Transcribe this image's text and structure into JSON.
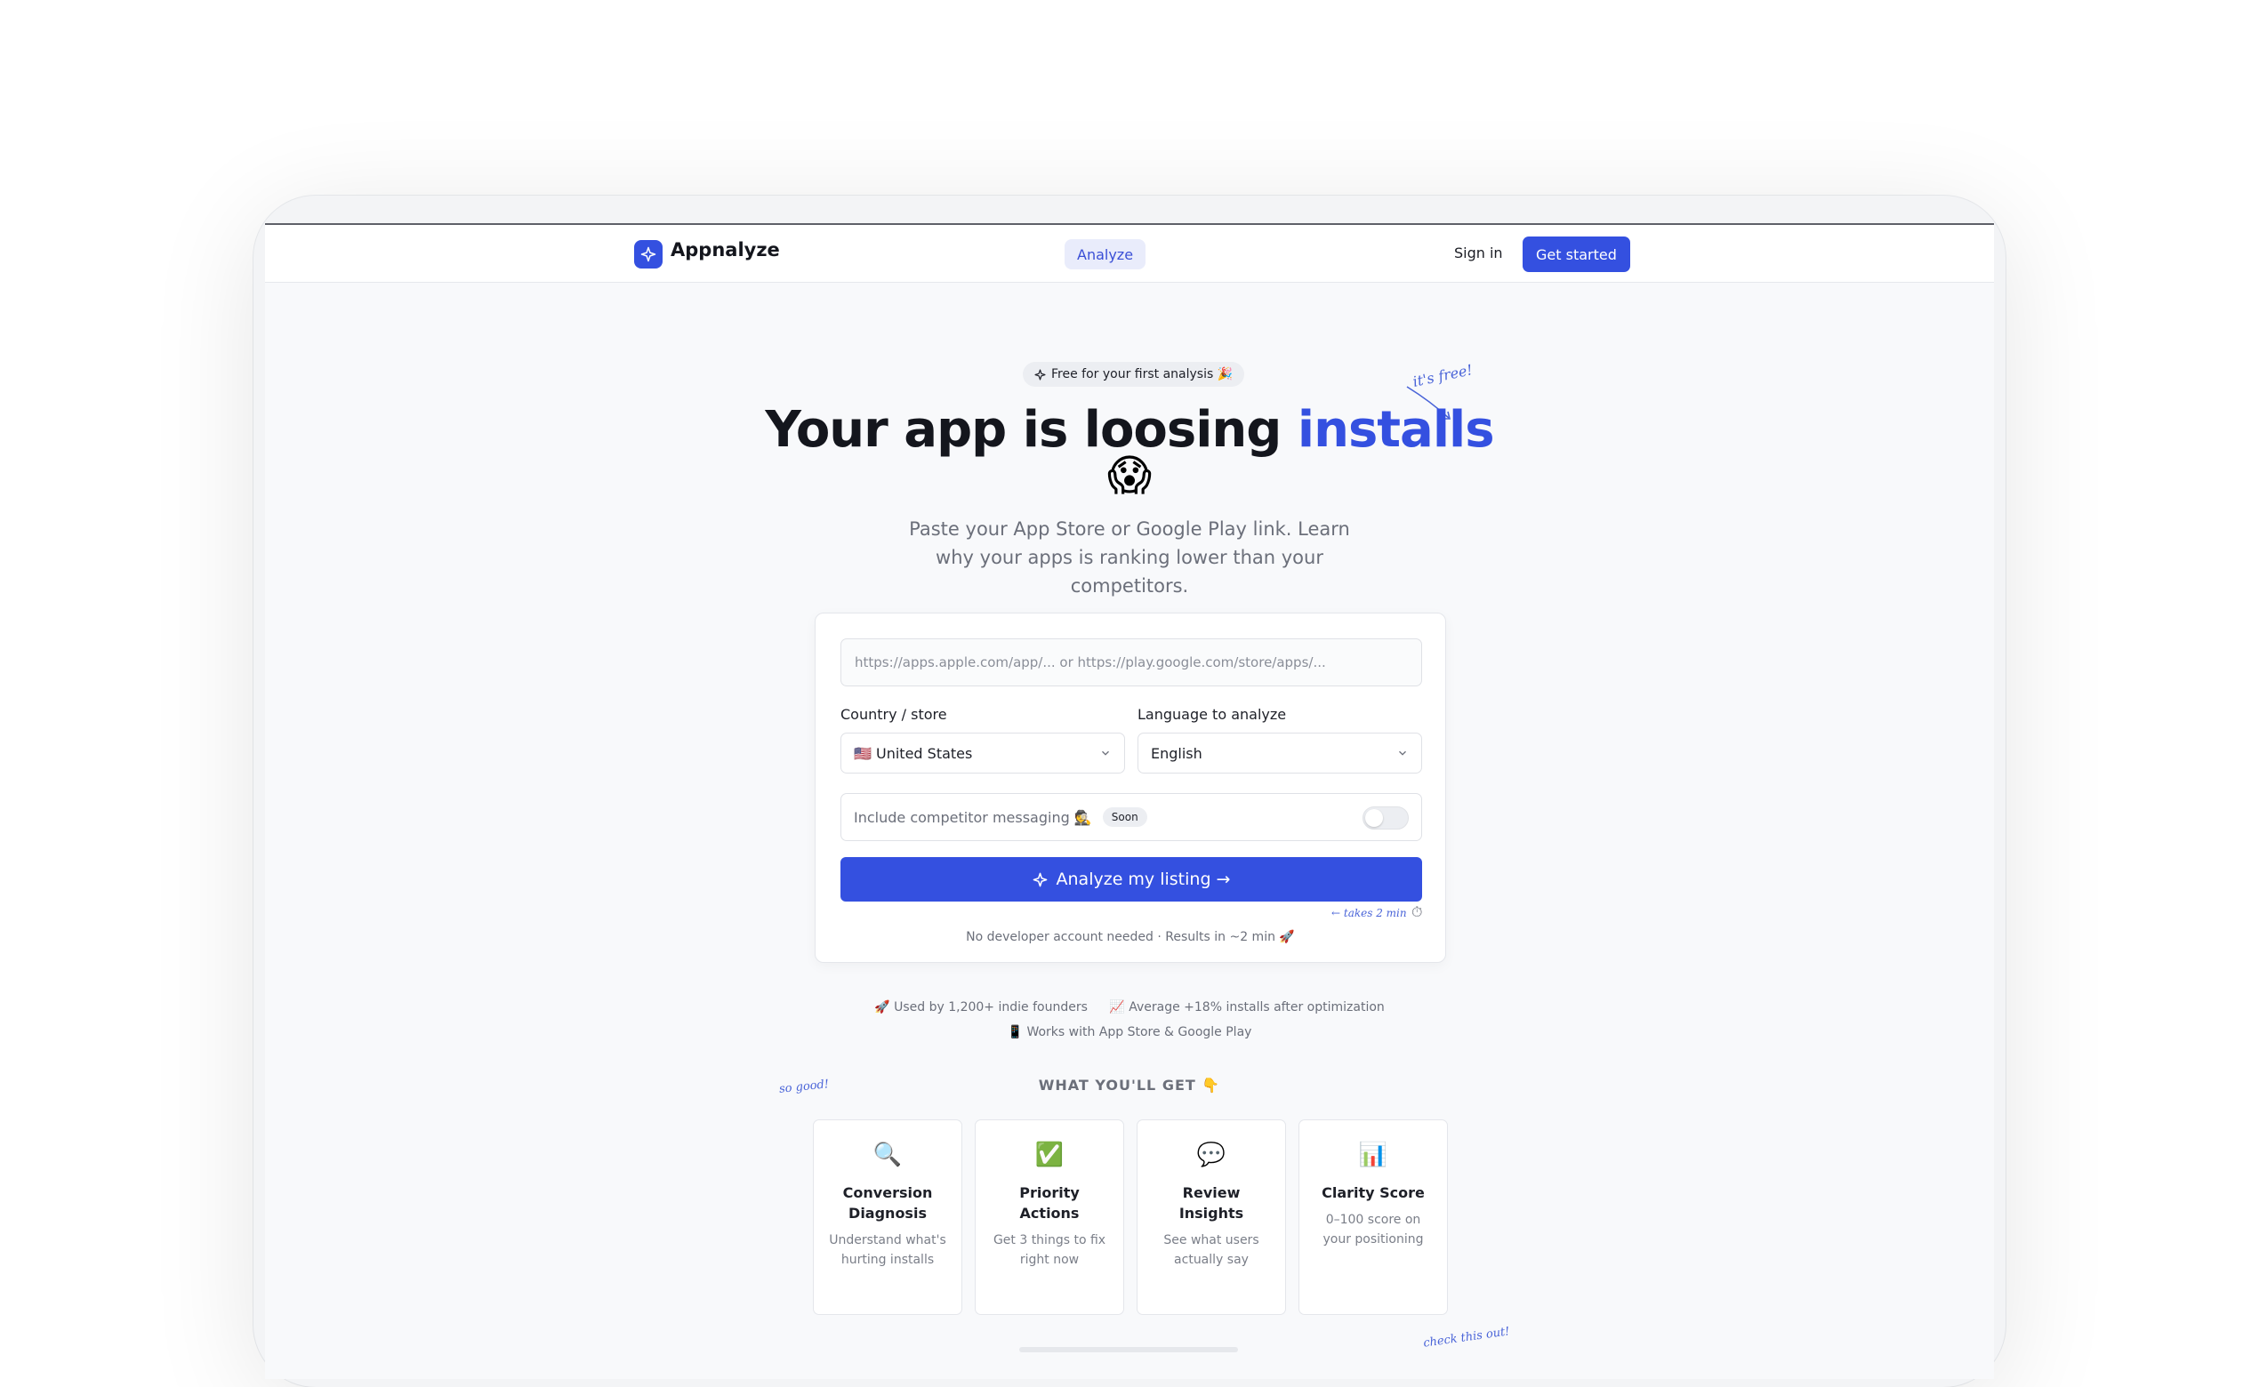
{
  "nav": {
    "brand": "Appnalyze",
    "analyze_label": "Analyze",
    "signin_label": "Sign in",
    "get_started_label": "Get started"
  },
  "hero": {
    "badge": "Free for your first analysis 🎉",
    "badge_icon": "sparkle-icon",
    "title_main": "Your app is loosing ",
    "title_accent": "installs",
    "title_emoji": "😱",
    "annotation_free": "it's free!",
    "subtitle": "Paste your App Store or Google Play link. Learn why your apps is ranking lower than your competitors."
  },
  "form": {
    "url_placeholder": "https://apps.apple.com/app/... or https://play.google.com/store/apps/...",
    "country_label": "Country / store",
    "country_value": "🇺🇸 United States",
    "language_label": "Language to analyze",
    "language_value": "English",
    "competitor_label": "Include competitor messaging 🕵️",
    "soon_badge": "Soon",
    "toggle_on": false,
    "cta_label": "Analyze my listing →",
    "takes_annotation": "← takes 2 min",
    "footnote": "No developer account needed · Results in ~2 min 🚀"
  },
  "stats": {
    "founders": "🚀 Used by 1,200+ indie founders",
    "average": "📈 Average +18% installs after optimization",
    "works": "📱 Works with App Store & Google Play"
  },
  "features": {
    "section_title": "WHAT YOU'LL GET 👇",
    "annotation_good": "so good!",
    "annotation_check": "check this out!",
    "items": [
      {
        "icon": "🔍",
        "title": "Conversion Diagnosis",
        "desc": "Understand what's hurting installs"
      },
      {
        "icon": "✅",
        "title": "Priority Actions",
        "desc": "Get 3 things to fix right now"
      },
      {
        "icon": "💬",
        "title": "Review Insights",
        "desc": "See what users actually say"
      },
      {
        "icon": "📊",
        "title": "Clarity Score",
        "desc": "0–100 score on your positioning"
      }
    ]
  },
  "colors": {
    "accent": "#3450e0",
    "text": "#14161d",
    "muted": "#6b6f7a",
    "background": "#f8f9fb"
  }
}
